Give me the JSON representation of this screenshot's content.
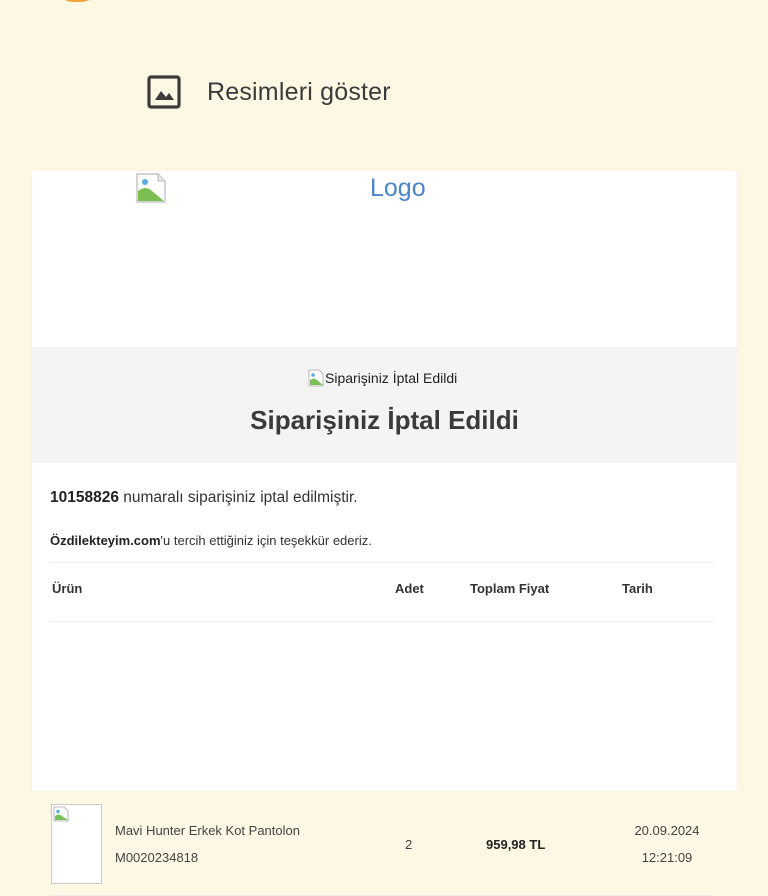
{
  "toolbar": {
    "show_images_label": "Resimleri göster",
    "show_images_icon": "image-icon"
  },
  "email": {
    "logo_alt": "Logo",
    "banner_img_alt": "Siparişiniz İptal Edildi",
    "banner_title": "Siparişiniz İptal Edildi",
    "order_number": "10158826",
    "order_text": " numaralı siparişiniz iptal edilmiştir.",
    "brand_name": "Özdilekteyim.com",
    "thanks_text": "'u tercih ettiğiniz için teşekkür ederiz.",
    "table": {
      "headers": {
        "product": "Ürün",
        "quantity": "Adet",
        "total": "Toplam Fiyat",
        "date": "Tarih"
      },
      "rows": [
        {
          "name": "Mavi Hunter Erkek Kot Pantolon",
          "sku": "M0020234818",
          "quantity": "2",
          "total": "959,98 TL",
          "date": "20.09.2024",
          "time": "12:21:09"
        }
      ]
    }
  },
  "colors": {
    "page_background": "#fdf8e4",
    "logo_link": "#4a86c8",
    "banner_background": "#f4f4f4"
  }
}
